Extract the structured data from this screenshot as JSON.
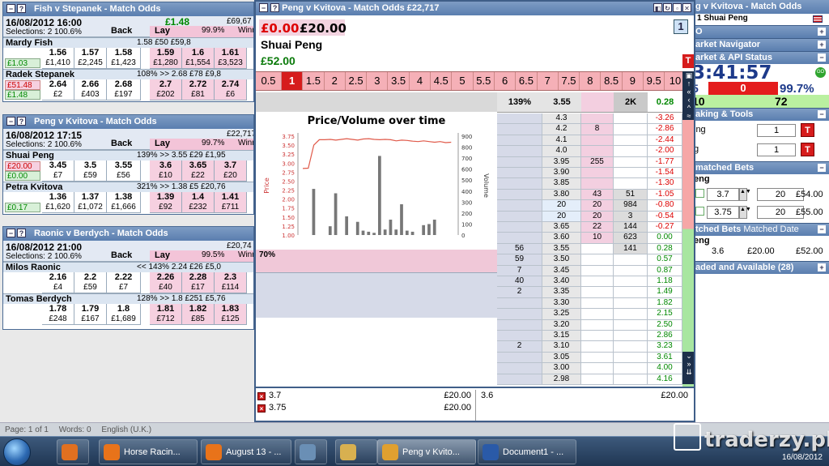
{
  "status_bar": {
    "page": "Page: 1 of 1",
    "words": "Words: 0",
    "language": "English (U.K.)"
  },
  "taskbar": {
    "items": [
      {
        "label": ""
      },
      {
        "label": "Horse Racin..."
      },
      {
        "label": "August 13 - ..."
      },
      {
        "label": ""
      },
      {
        "label": ""
      },
      {
        "label": "Peng v Kvito..."
      },
      {
        "label": "Document1 - ..."
      }
    ],
    "clock_date": "16/08/2012"
  },
  "watermark": "traderzy.pl",
  "mini_windows": [
    {
      "title": "Fish v Stepanek - Match Odds",
      "date_time": "16/08/2012  16:00",
      "selections": "Selections: 2  100.6%",
      "back_label": "Back",
      "lay_label": "Lay",
      "lay_pct": "99.9%",
      "win_label": "Winr",
      "top_value": "£1.48",
      "top_right": "£69,67",
      "runners": [
        {
          "name": "Mardy Fish",
          "info": "1.58     £50   £59,8",
          "pl_a": "",
          "pl_b": "£1.03",
          "back": [
            {
              "p": "1.56",
              "v": "£1,410"
            },
            {
              "p": "1.57",
              "v": "£2,245"
            },
            {
              "p": "1.58",
              "v": "£1,423"
            }
          ],
          "lay": [
            {
              "p": "1.59",
              "v": "£1,280"
            },
            {
              "p": "1.6",
              "v": "£1,554"
            },
            {
              "p": "1.61",
              "v": "£3,523"
            }
          ]
        },
        {
          "name": "Radek Stepanek",
          "info": "108% >>    2.68    £78   £9,8",
          "pl_a": "£51.48",
          "pl_b": "£1.48",
          "back": [
            {
              "p": "2.64",
              "v": "£2"
            },
            {
              "p": "2.66",
              "v": "£403"
            },
            {
              "p": "2.68",
              "v": "£197"
            }
          ],
          "lay": [
            {
              "p": "2.7",
              "v": "£202"
            },
            {
              "p": "2.72",
              "v": "£81"
            },
            {
              "p": "2.74",
              "v": "£6"
            }
          ]
        }
      ]
    },
    {
      "title": "Peng v Kvitova - Match Odds",
      "date_time": "16/08/2012  17:15",
      "selections": "Selections: 2  100.6%",
      "back_label": "Back",
      "lay_label": "Lay",
      "lay_pct": "99.7%",
      "win_label": "Winr",
      "top_value": "",
      "top_right": "£22,717",
      "runners": [
        {
          "name": "Shuai Peng",
          "info": "139% >>    3.55    £29   £1,95",
          "pl_a": "£20.00",
          "pl_b": "£0.00",
          "back": [
            {
              "p": "3.45",
              "v": "£7"
            },
            {
              "p": "3.5",
              "v": "£59"
            },
            {
              "p": "3.55",
              "v": "£56"
            }
          ],
          "lay": [
            {
              "p": "3.6",
              "v": "£10"
            },
            {
              "p": "3.65",
              "v": "£22"
            },
            {
              "p": "3.7",
              "v": "£20"
            }
          ]
        },
        {
          "name": "Petra Kvitova",
          "info": "321% >>    1.38     £5   £20,76",
          "pl_a": "",
          "pl_b": "£0.17",
          "back": [
            {
              "p": "1.36",
              "v": "£1,620"
            },
            {
              "p": "1.37",
              "v": "£1,072"
            },
            {
              "p": "1.38",
              "v": "£1,666"
            }
          ],
          "lay": [
            {
              "p": "1.39",
              "v": "£92"
            },
            {
              "p": "1.4",
              "v": "£232"
            },
            {
              "p": "1.41",
              "v": "£711"
            }
          ]
        }
      ]
    },
    {
      "title": "Raonic v Berdych - Match Odds",
      "date_time": "16/08/2012  21:00",
      "selections": "Selections: 2  100.6%",
      "back_label": "Back",
      "lay_label": "Lay",
      "lay_pct": "99.5%",
      "win_label": "Winr",
      "top_value": "",
      "top_right": "£20,74",
      "runners": [
        {
          "name": "Milos Raonic",
          "info": "<< 143%    2.24    £26   £5,0",
          "pl_a": "",
          "pl_b": "",
          "back": [
            {
              "p": "2.16",
              "v": "£4"
            },
            {
              "p": "2.2",
              "v": "£59"
            },
            {
              "p": "2.22",
              "v": "£7"
            }
          ],
          "lay": [
            {
              "p": "2.26",
              "v": "£40"
            },
            {
              "p": "2.28",
              "v": "£17"
            },
            {
              "p": "2.3",
              "v": "£114"
            }
          ]
        },
        {
          "name": "Tomas Berdych",
          "info": "128% >>    1.8    £251   £5,76",
          "pl_a": "",
          "pl_b": "",
          "back": [
            {
              "p": "1.78",
              "v": "£248"
            },
            {
              "p": "1.79",
              "v": "£167"
            },
            {
              "p": "1.8",
              "v": "£1,689"
            }
          ],
          "lay": [
            {
              "p": "1.81",
              "v": "£712"
            },
            {
              "p": "1.82",
              "v": "£85"
            },
            {
              "p": "1.83",
              "v": "£125"
            }
          ]
        }
      ]
    }
  ],
  "ladder": {
    "title": "Peng v Kvitova - Match Odds   £22,717",
    "pl_red": "£0.00",
    "stake": "£20.00",
    "runner": "Shuai Peng",
    "pl_green": "£52.00",
    "one_label": "1",
    "t_label": "T",
    "stakes": [
      "0.5",
      "1",
      "1.5",
      "2",
      "2.5",
      "3",
      "3.5",
      "4",
      "4.5",
      "5",
      "5.5",
      "6",
      "6.5",
      "7",
      "7.5",
      "8",
      "8.5",
      "9",
      "9.5",
      "10"
    ],
    "selected_stake": "1",
    "header": {
      "pct": "139%",
      "ltp": "3.55",
      "vol": "2K",
      "pl": "0.28"
    },
    "lower_pct": "70%",
    "rows": [
      {
        "back": "",
        "price": "4.3",
        "lay": "",
        "vol": "",
        "pl": "-3.26"
      },
      {
        "back": "",
        "price": "4.2",
        "lay": "8",
        "vol": "",
        "pl": "-2.86"
      },
      {
        "back": "",
        "price": "4.1",
        "lay": "",
        "vol": "",
        "pl": "-2.44"
      },
      {
        "back": "",
        "price": "4.0",
        "lay": "",
        "vol": "",
        "pl": "-2.00"
      },
      {
        "back": "",
        "price": "3.95",
        "lay": "255",
        "vol": "",
        "pl": "-1.77"
      },
      {
        "back": "",
        "price": "3.90",
        "lay": "",
        "vol": "",
        "pl": "-1.54"
      },
      {
        "back": "",
        "price": "3.85",
        "lay": "",
        "vol": "",
        "pl": "-1.30"
      },
      {
        "back": "",
        "price": "3.80",
        "lay": "43",
        "vol": "51",
        "pl": "-1.05"
      },
      {
        "back": "",
        "price": "20",
        "lay": "20",
        "vol": "984",
        "pl": "-0.80"
      },
      {
        "back": "",
        "price": "20",
        "lay": "20",
        "vol": "3",
        "pl": "-0.54"
      },
      {
        "back": "",
        "price": "3.65",
        "lay": "22",
        "vol": "144",
        "pl": "-0.27"
      },
      {
        "back": "",
        "price": "3.60",
        "lay": "10",
        "vol": "623",
        "pl": "0.00"
      },
      {
        "back": "56",
        "price": "3.55",
        "lay": "",
        "vol": "141",
        "pl": "0.28"
      },
      {
        "back": "59",
        "price": "3.50",
        "lay": "",
        "vol": "",
        "pl": "0.57"
      },
      {
        "back": "7",
        "price": "3.45",
        "lay": "",
        "vol": "",
        "pl": "0.87"
      },
      {
        "back": "40",
        "price": "3.40",
        "lay": "",
        "vol": "",
        "pl": "1.18"
      },
      {
        "back": "2",
        "price": "3.35",
        "lay": "",
        "vol": "",
        "pl": "1.49"
      },
      {
        "back": "",
        "price": "3.30",
        "lay": "",
        "vol": "",
        "pl": "1.82"
      },
      {
        "back": "",
        "price": "3.25",
        "lay": "",
        "vol": "",
        "pl": "2.15"
      },
      {
        "back": "",
        "price": "3.20",
        "lay": "",
        "vol": "",
        "pl": "2.50"
      },
      {
        "back": "",
        "price": "3.15",
        "lay": "",
        "vol": "",
        "pl": "2.86"
      },
      {
        "back": "2",
        "price": "3.10",
        "lay": "",
        "vol": "",
        "pl": "3.23"
      },
      {
        "back": "",
        "price": "3.05",
        "lay": "",
        "vol": "",
        "pl": "3.61"
      },
      {
        "back": "",
        "price": "3.00",
        "lay": "",
        "vol": "",
        "pl": "4.00"
      },
      {
        "back": "",
        "price": "2.98",
        "lay": "",
        "vol": "",
        "pl": "4.16"
      }
    ],
    "bets_left": [
      {
        "price": "3.7",
        "amount": "£20.00"
      },
      {
        "price": "3.75",
        "amount": "£20.00"
      }
    ],
    "bets_right": [
      {
        "price": "3.6",
        "amount": "£20.00"
      }
    ]
  },
  "chart_data": {
    "type": "bar",
    "title": "Price/Volume over time",
    "ylabel": "Price",
    "y2label": "Volume",
    "yticks": [
      "3.75",
      "3.50",
      "3.25",
      "3.00",
      "2.75",
      "2.50",
      "2.25",
      "2.00",
      "1.75",
      "1.50",
      "1.25",
      "1.00"
    ],
    "y2ticks": [
      "900",
      "800",
      "700",
      "600",
      "500",
      "400",
      "300",
      "200",
      "100",
      "0"
    ],
    "ylim": [
      1.0,
      3.75
    ],
    "y2lim": [
      0,
      900
    ],
    "price_line": [
      2.85,
      2.86,
      3.5,
      3.65,
      3.65,
      3.66,
      3.64,
      3.66,
      3.68,
      3.66,
      3.64,
      3.67,
      3.68,
      3.66,
      3.65,
      3.66,
      3.65,
      3.62,
      3.64,
      3.63,
      3.61,
      3.6,
      3.62,
      3.6,
      3.58,
      3.6,
      3.57,
      3.58
    ],
    "volume_bars": [
      0,
      0,
      420,
      0,
      0,
      80,
      380,
      0,
      170,
      0,
      120,
      40,
      30,
      20,
      720,
      50,
      140,
      50,
      280,
      40,
      30,
      0,
      90,
      100,
      140,
      0,
      0,
      0
    ]
  },
  "right_panel": {
    "window_title": "g v Kvitova - Match Odds",
    "runner_small": "1  Shuai Peng",
    "sections": {
      "o": "O",
      "market_navigator": "arket Navigator",
      "market_api": "arket & API Status",
      "staking": "aking & Tools",
      "unmatched": "matched Bets",
      "matched": "tched Bets",
      "matched_date": "Matched Date",
      "traded": "aded and Available (28)"
    },
    "clock": "3:41:57",
    "status_left": "5",
    "status_mid": "0",
    "status_pct": "99.7%",
    "status_b_left": "10",
    "status_b_right": "72",
    "staking_rows": [
      {
        "label": "ing",
        "value": "1"
      },
      {
        "label": "g",
        "value": "1"
      }
    ],
    "unmatched_runner": "eng",
    "unmatched": [
      {
        "odds": "3.7",
        "stake": "20",
        "profit": "£54.00"
      },
      {
        "odds": "3.75",
        "stake": "20",
        "profit": "£55.00"
      }
    ],
    "matched_runner": "eng",
    "matched": [
      {
        "odds": "3.6",
        "stake": "£20.00",
        "profit": "£52.00"
      }
    ]
  }
}
